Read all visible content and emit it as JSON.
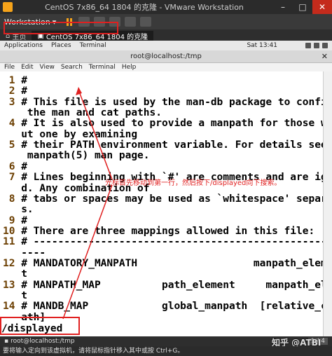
{
  "vmware": {
    "window_title": "CentOS 7x86_64 1804 的克隆 - VMware Workstation",
    "toolbar_label": "Workstation",
    "tabs": [
      {
        "label": "主页"
      },
      {
        "label": "CentOS 7x86_64 1804 的克隆"
      }
    ],
    "status_text": "要将输入定向到该虚拟机，请将鼠标指针移入其中或按 Ctrl+G。"
  },
  "gnome": {
    "applications": "Applications",
    "places": "Places",
    "terminal": "Terminal",
    "clock": "Sat 13:41"
  },
  "terminal": {
    "title": "root@localhost:/tmp",
    "menu": [
      "File",
      "Edit",
      "View",
      "Search",
      "Terminal",
      "Help"
    ],
    "lines": [
      {
        "n": " 1",
        "t": " #"
      },
      {
        "n": " 2",
        "t": " #"
      },
      {
        "n": " 3",
        "t": " # This file is used by the man-db package to configure"
      },
      {
        "n": "",
        "t": "    the man and cat paths."
      },
      {
        "n": " 4",
        "t": " # It is also used to provide a manpath for those witho"
      },
      {
        "n": "",
        "t": "   ut one by examining"
      },
      {
        "n": " 5",
        "t": " # their PATH environment variable. For details see the"
      },
      {
        "n": "",
        "t": "    manpath(5) man page."
      },
      {
        "n": " 6",
        "t": " #"
      },
      {
        "n": " 7",
        "t": " # Lines beginning with `#' are comments and are ignore"
      },
      {
        "n": "",
        "t": "   d. Any combination of"
      },
      {
        "n": " 8",
        "t": " # tabs or spaces may be used as `whitespace' separator"
      },
      {
        "n": "",
        "t": "   s."
      },
      {
        "n": " 9",
        "t": " #"
      },
      {
        "n": "10",
        "t": " # There are three mappings allowed in this file:"
      },
      {
        "n": "11",
        "t": " # ---------------------------------------------------"
      },
      {
        "n": "",
        "t": "   ----"
      },
      {
        "n": "12",
        "t": " # MANDATORY_MANPATH                   manpath_elemen"
      },
      {
        "n": "",
        "t": "   t"
      },
      {
        "n": "13",
        "t": " # MANPATH_MAP          path_element     manpath_elemen"
      },
      {
        "n": "",
        "t": "   t"
      },
      {
        "n": "14",
        "t": " # MANDB_MAP            global_manpath  [relative_catp"
      },
      {
        "n": "",
        "t": "   ath]"
      }
    ],
    "command": "/displayed"
  },
  "annotation": {
    "text": "光标首先移动到第一行，然后按下/displayed向下搜索。"
  },
  "guest_taskbar": {
    "item": "root@localhost:/tmp",
    "pager": "1 / 4"
  },
  "watermark": "知乎 @ATBI"
}
